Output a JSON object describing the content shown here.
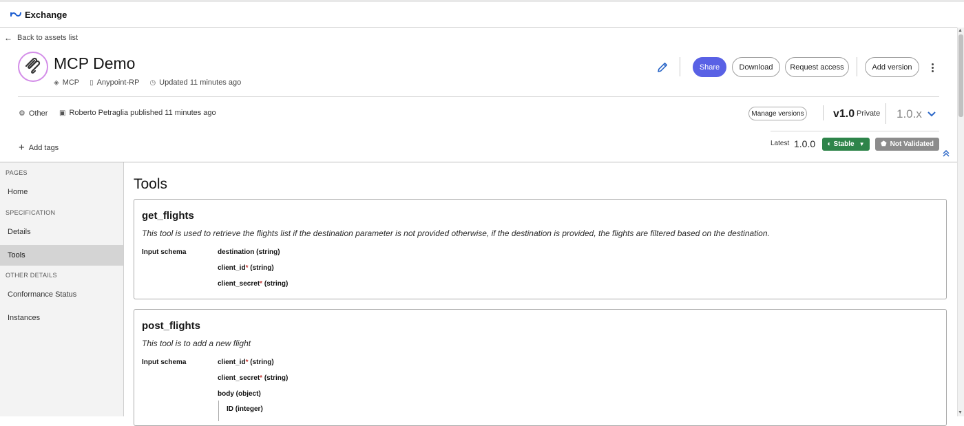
{
  "app": {
    "title": "Exchange"
  },
  "nav": {
    "back_label": "Back to assets list"
  },
  "asset": {
    "title": "MCP Demo",
    "type": "MCP",
    "org": "Anypoint-RP",
    "updated": "Updated 11 minutes ago",
    "category": "Other",
    "published": "Roberto Petraglia published 11 minutes ago"
  },
  "actions": {
    "share": "Share",
    "download": "Download",
    "request_access": "Request access",
    "add_version": "Add version",
    "manage_versions": "Manage versions",
    "add_tags": "Add tags"
  },
  "version": {
    "current": "v1.0",
    "visibility": "Private",
    "selected": "1.0.x",
    "latest_label": "Latest",
    "latest_value": "1.0.0",
    "stability": "Stable",
    "validation": "Not Validated"
  },
  "sidebar": {
    "sections": [
      {
        "heading": "PAGES",
        "items": [
          "Home"
        ]
      },
      {
        "heading": "SPECIFICATION",
        "items": [
          "Details",
          "Tools"
        ]
      },
      {
        "heading": "OTHER DETAILS",
        "items": [
          "Conformance Status",
          "Instances"
        ]
      }
    ],
    "active": "Tools"
  },
  "main": {
    "title": "Tools",
    "schema_label": "Input schema",
    "tools": [
      {
        "name": "get_flights",
        "description": "This tool is used to retrieve the flights list if the destination parameter is not provided otherwise, if the destination is provided, the flights are filtered based on the destination.",
        "params": [
          {
            "name": "destination",
            "type": "(string)",
            "required": false
          },
          {
            "name": "client_id",
            "type": "(string)",
            "required": true
          },
          {
            "name": "client_secret",
            "type": "(string)",
            "required": true
          }
        ]
      },
      {
        "name": "post_flights",
        "description": "This tool is to add a new flight",
        "params": [
          {
            "name": "client_id",
            "type": "(string)",
            "required": true
          },
          {
            "name": "client_secret",
            "type": "(string)",
            "required": true
          },
          {
            "name": "body",
            "type": "(object)",
            "required": false
          },
          {
            "name": "ID",
            "type": "(integer)",
            "required": false
          }
        ]
      }
    ]
  },
  "colors": {
    "primary": "#5961e5",
    "stable": "#2e844a",
    "not_validated": "#8c8c8c",
    "required": "#c23934",
    "link": "#2a66c7"
  }
}
